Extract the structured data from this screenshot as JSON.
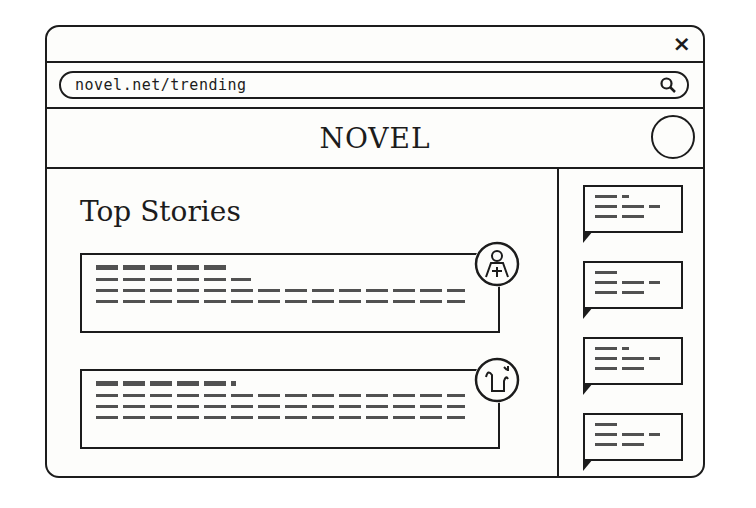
{
  "window": {
    "close": "×"
  },
  "address_bar": {
    "url": "novel.net/trending"
  },
  "header": {
    "logo": "NOVEL"
  },
  "main": {
    "title": "Top Stories",
    "stories": [
      {},
      {}
    ]
  },
  "sidebar": {
    "comments": [
      {},
      {},
      {},
      {}
    ]
  }
}
